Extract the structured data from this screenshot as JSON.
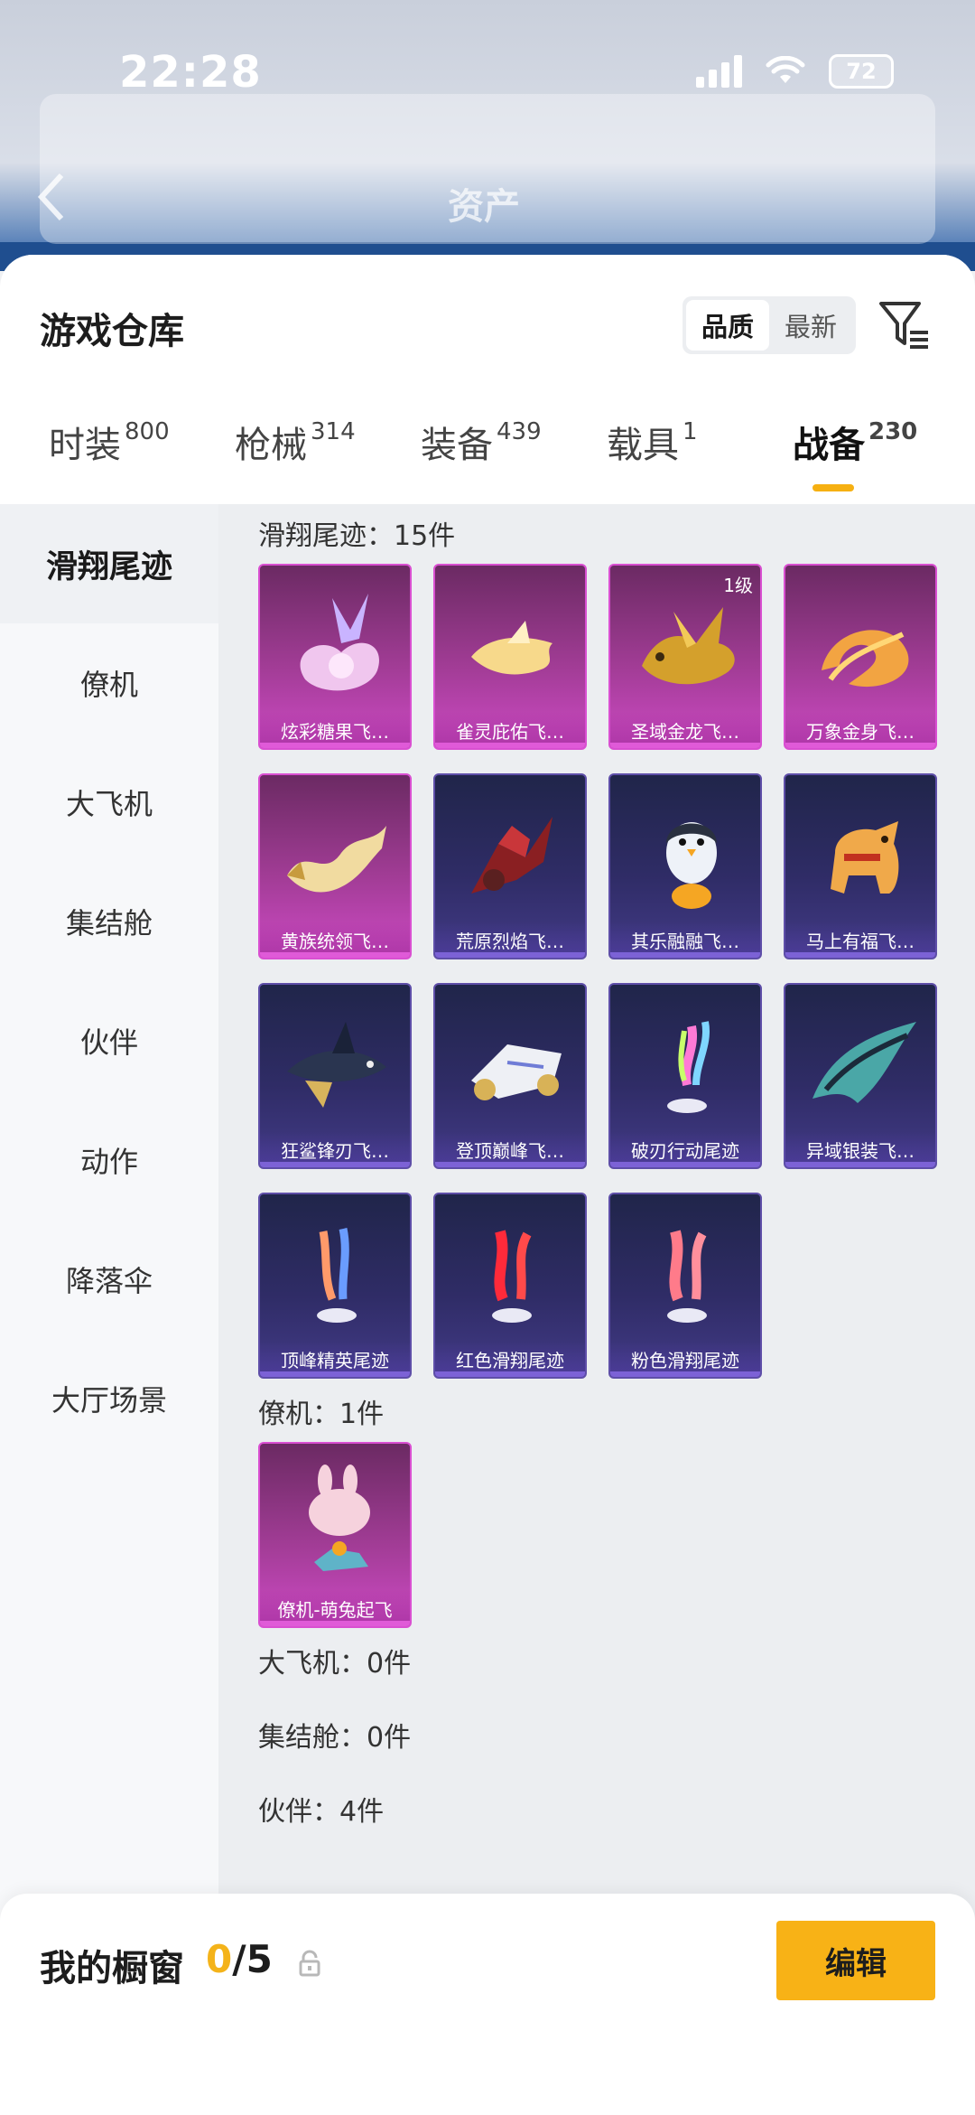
{
  "status_bar": {
    "time": "22:28",
    "battery": "72"
  },
  "background": {
    "title": "资产"
  },
  "header": {
    "title": "游戏仓库",
    "sort_options": [
      "品质",
      "最新"
    ],
    "sort_active": "品质"
  },
  "tabs": [
    {
      "label": "时装",
      "count": "800"
    },
    {
      "label": "枪械",
      "count": "314"
    },
    {
      "label": "装备",
      "count": "439"
    },
    {
      "label": "载具",
      "count": "1"
    },
    {
      "label": "战备",
      "count": "230"
    }
  ],
  "active_tab": "战备",
  "sidebar": {
    "items": [
      "滑翔尾迹",
      "僚机",
      "大飞机",
      "集结舱",
      "伙伴",
      "动作",
      "降落伞",
      "大厅场景"
    ],
    "active": "滑翔尾迹"
  },
  "sections": [
    {
      "label": "滑翔尾迹：15件",
      "items": [
        {
          "name": "炫彩糖果飞…",
          "rarity": "purple",
          "icon": "candy-wing"
        },
        {
          "name": "雀灵庇佑飞…",
          "rarity": "purple",
          "icon": "golden-bird"
        },
        {
          "name": "圣域金龙飞…",
          "rarity": "purple",
          "icon": "gold-dragon",
          "level": "1级"
        },
        {
          "name": "万象金身飞…",
          "rarity": "purple",
          "icon": "fire-swirl"
        },
        {
          "name": "黄族统领飞…",
          "rarity": "purple",
          "icon": "eastern-dragon"
        },
        {
          "name": "荒原烈焰飞…",
          "rarity": "blue",
          "icon": "red-mech"
        },
        {
          "name": "其乐融融飞…",
          "rarity": "blue",
          "icon": "penguin"
        },
        {
          "name": "马上有福飞…",
          "rarity": "blue",
          "icon": "toy-horse"
        },
        {
          "name": "狂鲨锋刃飞…",
          "rarity": "blue",
          "icon": "shark"
        },
        {
          "name": "登顶巅峰飞…",
          "rarity": "blue",
          "icon": "white-jet"
        },
        {
          "name": "破刃行动尾迹",
          "rarity": "blue",
          "icon": "rainbow-trail"
        },
        {
          "name": "异域银装飞…",
          "rarity": "blue",
          "icon": "teal-wing"
        },
        {
          "name": "顶峰精英尾迹",
          "rarity": "blue",
          "icon": "multicolor-trail"
        },
        {
          "name": "红色滑翔尾迹",
          "rarity": "blue",
          "icon": "red-trail"
        },
        {
          "name": "粉色滑翔尾迹",
          "rarity": "blue",
          "icon": "pink-trail"
        }
      ]
    },
    {
      "label": "僚机：1件",
      "items": [
        {
          "name": "僚机-萌兔起飞",
          "rarity": "purple",
          "icon": "bunny-drone"
        }
      ]
    },
    {
      "label": "大飞机：0件",
      "items": []
    },
    {
      "label": "集结舱：0件",
      "items": []
    },
    {
      "label": "伙伴：4件",
      "items": []
    }
  ],
  "showcase": {
    "label": "我的橱窗",
    "current": "0",
    "total": "/5",
    "edit_label": "编辑"
  },
  "colors": {
    "accent": "#f8b216",
    "purple_card": "#a13c95",
    "blue_card": "#2f2c66"
  }
}
